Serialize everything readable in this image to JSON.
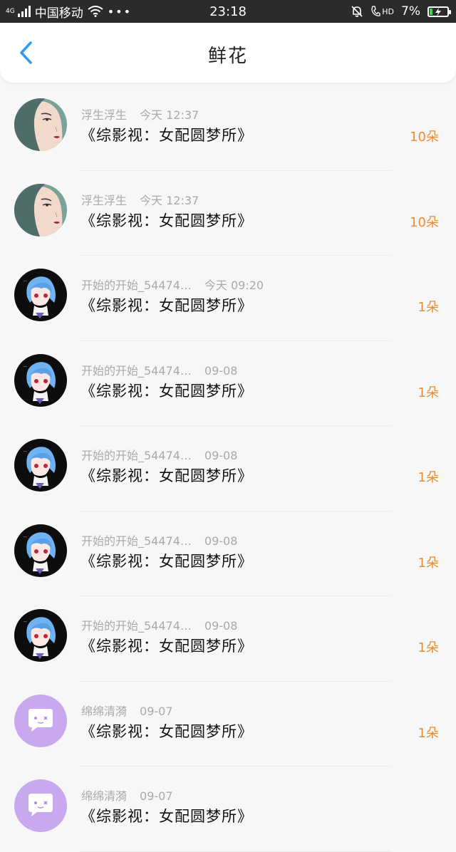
{
  "status_bar": {
    "network_tag": "4G",
    "carrier": "中国移动",
    "more": "•••",
    "time": "23:18",
    "hd": "HD",
    "battery_percent": "7%",
    "battery_level": 0.07
  },
  "header": {
    "title": "鲜花"
  },
  "items": [
    {
      "name": "浮生浮生",
      "time": "今天 12:37",
      "book": "《综影视：女配圆梦所》",
      "count": "10朵",
      "avatar": "portrait"
    },
    {
      "name": "浮生浮生",
      "time": "今天 12:37",
      "book": "《综影视：女配圆梦所》",
      "count": "10朵",
      "avatar": "portrait"
    },
    {
      "name": "开始的开始_54474…",
      "time": "今天 09:20",
      "book": "《综影视：女配圆梦所》",
      "count": "1朵",
      "avatar": "anime"
    },
    {
      "name": "开始的开始_54474…",
      "time": "09-08",
      "book": "《综影视：女配圆梦所》",
      "count": "1朵",
      "avatar": "anime"
    },
    {
      "name": "开始的开始_54474…",
      "time": "09-08",
      "book": "《综影视：女配圆梦所》",
      "count": "1朵",
      "avatar": "anime"
    },
    {
      "name": "开始的开始_54474…",
      "time": "09-08",
      "book": "《综影视：女配圆梦所》",
      "count": "1朵",
      "avatar": "anime"
    },
    {
      "name": "开始的开始_54474…",
      "time": "09-08",
      "book": "《综影视：女配圆梦所》",
      "count": "1朵",
      "avatar": "anime"
    },
    {
      "name": "绵绵清漪",
      "time": "09-07",
      "book": "《综影视：女配圆梦所》",
      "count": "1朵",
      "avatar": "default"
    },
    {
      "name": "绵绵清漪",
      "time": "09-07",
      "book": "《综影视：女配圆梦所》",
      "count": "",
      "avatar": "default"
    }
  ],
  "colors": {
    "accent_blue": "#2e9bf0",
    "count_orange": "#f08a2c",
    "default_avatar_purple": "#c8a8ee"
  }
}
